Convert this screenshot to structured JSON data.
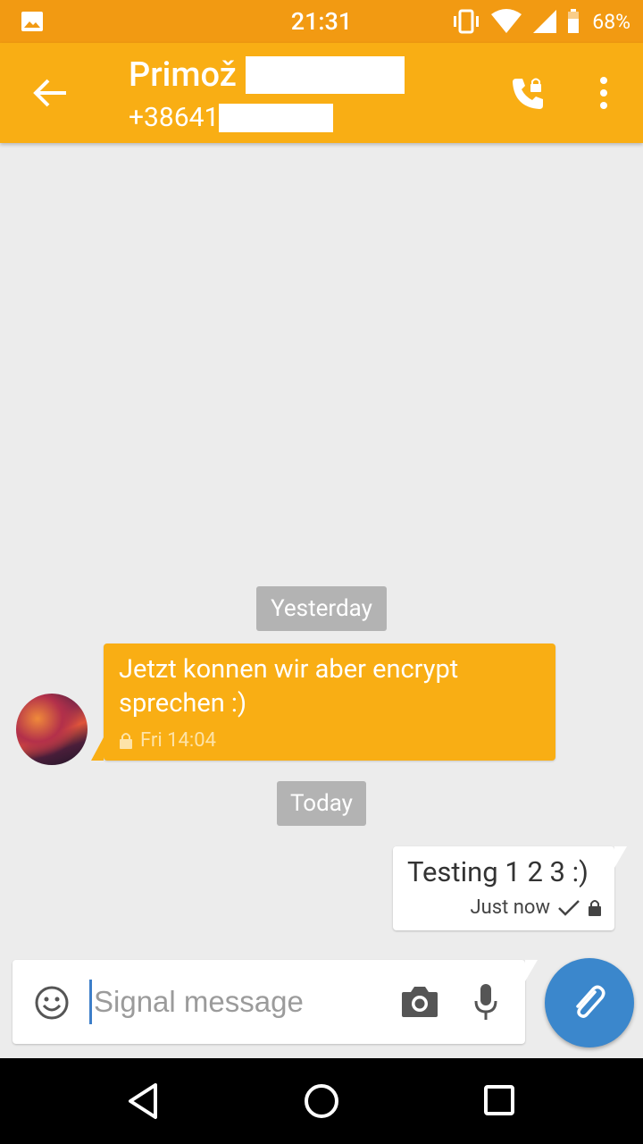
{
  "status_bar": {
    "time": "21:31",
    "battery_percent": "68%"
  },
  "app_bar": {
    "contact_name": "Primož",
    "contact_number": "+38641"
  },
  "conversation": {
    "date_dividers": [
      "Yesterday",
      "Today"
    ],
    "incoming_message": {
      "text": "Jetzt konnen wir aber encrypt sprechen :)",
      "timestamp": "Fri 14:04"
    },
    "outgoing_message": {
      "text": "Testing 1 2 3 :)",
      "timestamp": "Just now"
    }
  },
  "composer": {
    "placeholder": "Signal message"
  },
  "colors": {
    "status_bar": "#f29a12",
    "app_bar": "#f9ae14",
    "fab": "#3b87cc",
    "chip": "#b3b3b3"
  }
}
